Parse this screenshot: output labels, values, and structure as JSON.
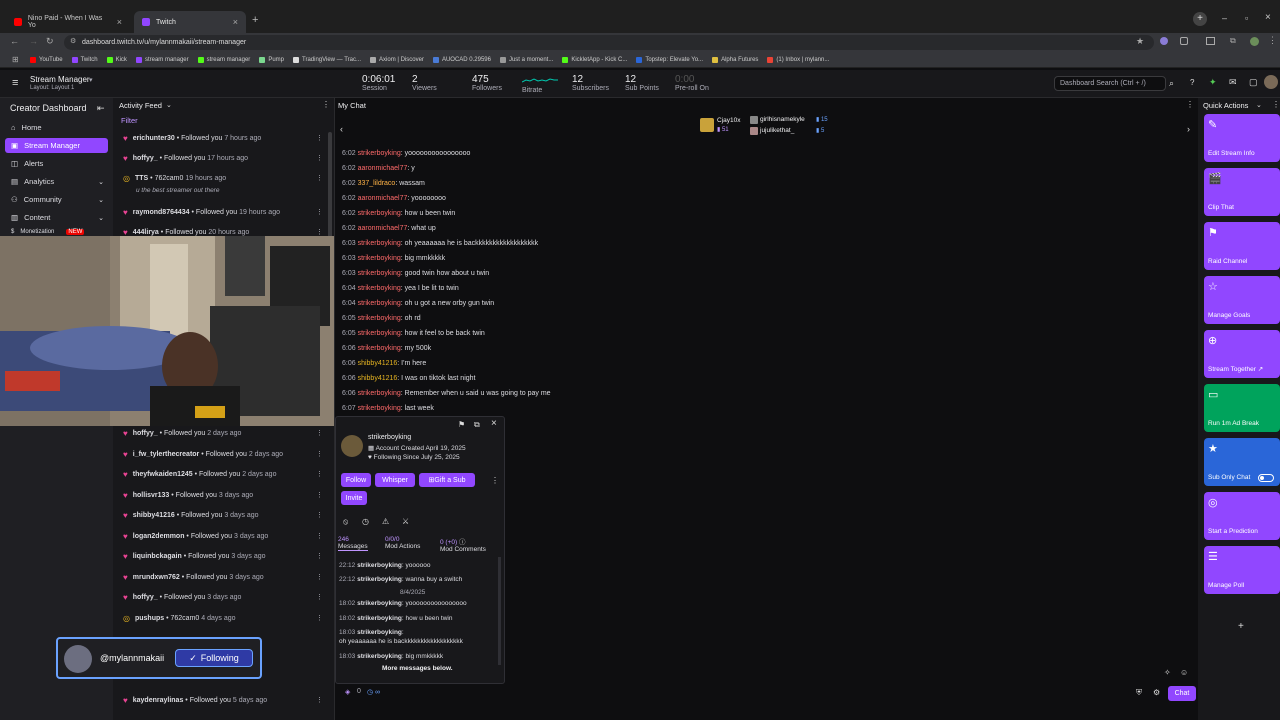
{
  "browser": {
    "tabs": [
      {
        "title": "Nino Paid - When I Was Yo",
        "favicon_color": "#ff0000"
      },
      {
        "title": "Twitch",
        "favicon_color": "#9146ff"
      }
    ],
    "url": "dashboard.twitch.tv/u/mylannmakaii/stream-manager",
    "bookmarks": [
      "YouTube",
      "Twitch",
      "Kick",
      "stream manager",
      "stream manager",
      "Pump",
      "TradingView — Trac...",
      "Axiom | Discover",
      "AUOCAD 0.29596",
      "Just a moment...",
      "KickletApp - Kick C...",
      "Topstep: Elevate Yo...",
      "Alpha Futures",
      "(1) Inbox | mylann..."
    ]
  },
  "header": {
    "title": "Stream Manager",
    "subtitle": "Layout: Layout 1",
    "stats": [
      {
        "value": "0:06:01",
        "label": "Session"
      },
      {
        "value": "2",
        "label": "Viewers"
      },
      {
        "value": "475",
        "label": "Followers"
      },
      {
        "value": "",
        "label": "Bitrate"
      },
      {
        "value": "12",
        "label": "Subscribers"
      },
      {
        "value": "12",
        "label": "Sub Points"
      },
      {
        "value": "0:00",
        "label": "Pre-roll On"
      }
    ],
    "search_placeholder": "Dashboard Search (Ctrl + /)"
  },
  "sidebar": {
    "title": "Creator Dashboard",
    "items": [
      {
        "label": "Home"
      },
      {
        "label": "Stream Manager"
      },
      {
        "label": "Alerts"
      },
      {
        "label": "Analytics"
      },
      {
        "label": "Community"
      },
      {
        "label": "Content"
      },
      {
        "label": "Monetization"
      }
    ],
    "new_badge": "NEW"
  },
  "feed": {
    "title": "Activity Feed",
    "filter": "Filter",
    "items": [
      {
        "name": "erichunter30",
        "action": "Followed you",
        "time": "7 hours ago",
        "type": "follow"
      },
      {
        "name": "hoffyy_",
        "action": "Followed you",
        "time": "17 hours ago",
        "type": "follow"
      },
      {
        "name": "TTS",
        "action": "762cam0",
        "time": "19 hours ago",
        "type": "points",
        "note": "u the best streamer out there"
      },
      {
        "name": "raymond8764434",
        "action": "Followed you",
        "time": "19 hours ago",
        "type": "follow"
      },
      {
        "name": "444lirya",
        "action": "Followed you",
        "time": "20 hours ago",
        "type": "follow"
      },
      {
        "name": "hoffyy_",
        "action": "Followed you",
        "time": "2 days ago",
        "type": "follow"
      },
      {
        "name": "i_fw_tylerthecreator",
        "action": "Followed you",
        "time": "2 days ago",
        "type": "follow"
      },
      {
        "name": "theyfwkaiden1245",
        "action": "Followed you",
        "time": "2 days ago",
        "type": "follow"
      },
      {
        "name": "hollisvr133",
        "action": "Followed you",
        "time": "3 days ago",
        "type": "follow"
      },
      {
        "name": "shibby41216",
        "action": "Followed you",
        "time": "3 days ago",
        "type": "follow"
      },
      {
        "name": "logan2demmon",
        "action": "Followed you",
        "time": "3 days ago",
        "type": "follow"
      },
      {
        "name": "liquinbckagain",
        "action": "Followed you",
        "time": "3 days ago",
        "type": "follow"
      },
      {
        "name": "mrundxwn762",
        "action": "Followed you",
        "time": "3 days ago",
        "type": "follow"
      },
      {
        "name": "hoffyy_",
        "action": "Followed you",
        "time": "3 days ago",
        "type": "follow"
      },
      {
        "name": "pushups",
        "action": "762cam0",
        "time": "4 days ago",
        "type": "points"
      },
      {
        "name": "kaydenraylinas",
        "action": "Followed you",
        "time": "5 days ago",
        "type": "follow"
      }
    ]
  },
  "follow_card": {
    "handle": "@mylannmakaii",
    "button": "Following"
  },
  "chat": {
    "title": "My Chat",
    "top_users": [
      {
        "name": "Cjay10x",
        "count": "51"
      },
      {
        "name": "girlhisnamekyle",
        "count": "15"
      },
      {
        "name": "jujulikethat_",
        "count": "5"
      }
    ],
    "messages": [
      {
        "time": "6:02",
        "user": "strikerboyking",
        "color": "#ff6a6a",
        "text": "yoooooooooooooooo"
      },
      {
        "time": "6:02",
        "user": "aaronmichael77",
        "color": "#ff6a6a",
        "text": "y"
      },
      {
        "time": "6:02",
        "user": "337_lildraco",
        "color": "#ffb347",
        "text": "wassam"
      },
      {
        "time": "6:02",
        "user": "aaronmichael77",
        "color": "#ff6a6a",
        "text": "yoooooooo"
      },
      {
        "time": "6:02",
        "user": "strikerboyking",
        "color": "#ff6a6a",
        "text": "how u been twin"
      },
      {
        "time": "6:02",
        "user": "aaronmichael77",
        "color": "#ff6a6a",
        "text": "what up"
      },
      {
        "time": "6:03",
        "user": "strikerboyking",
        "color": "#ff6a6a",
        "text": "oh yeaaaaaa he is backkkkkkkkkkkkkkkkkk"
      },
      {
        "time": "6:03",
        "user": "strikerboyking",
        "color": "#ff6a6a",
        "text": "big mmkkkkk"
      },
      {
        "time": "6:03",
        "user": "strikerboyking",
        "color": "#ff6a6a",
        "text": "good twin how about u twin"
      },
      {
        "time": "6:04",
        "user": "strikerboyking",
        "color": "#ff6a6a",
        "text": "yea I be lit to twin"
      },
      {
        "time": "6:04",
        "user": "strikerboyking",
        "color": "#ff6a6a",
        "text": "oh u got a new orby gun twin"
      },
      {
        "time": "6:05",
        "user": "strikerboyking",
        "color": "#ff6a6a",
        "text": "oh rd"
      },
      {
        "time": "6:05",
        "user": "strikerboyking",
        "color": "#ff6a6a",
        "text": "how it feel to be back twin"
      },
      {
        "time": "6:06",
        "user": "strikerboyking",
        "color": "#ff6a6a",
        "text": "my 500k"
      },
      {
        "time": "6:06",
        "user": "shibby41216",
        "color": "#e6b422",
        "text": "I'm here"
      },
      {
        "time": "6:06",
        "user": "shibby41216",
        "color": "#e6b422",
        "text": "I was on tiktok last night"
      },
      {
        "time": "6:06",
        "user": "strikerboyking",
        "color": "#ff6a6a",
        "text": "Remember when u said u was going to pay me"
      },
      {
        "time": "6:07",
        "user": "strikerboyking",
        "color": "#ff6a6a",
        "text": "last week"
      }
    ]
  },
  "user_card": {
    "username": "strikerboyking",
    "created": "Account Created April 19, 2025",
    "following": "Following Since July 25, 2025",
    "buttons": [
      "Follow",
      "Whisper",
      "Gift a Sub",
      "Invite"
    ],
    "stats": [
      {
        "value": "246",
        "label": "Messages"
      },
      {
        "value": "0/0/0",
        "label": "Mod Actions"
      },
      {
        "value": "0 (+0)",
        "label": "Mod Comments"
      }
    ],
    "log": [
      {
        "time": "22:12",
        "user": "strikerboyking",
        "text": "yoooooo"
      },
      {
        "time": "22:12",
        "user": "strikerboyking",
        "text": "wanna buy a switch"
      },
      {
        "date": "8/4/2025"
      },
      {
        "time": "18:02",
        "user": "strikerboyking",
        "text": "yoooooooooooooooo"
      },
      {
        "time": "18:02",
        "user": "strikerboyking",
        "text": "how u been twin"
      },
      {
        "time": "18:03",
        "user": "strikerboyking",
        "text": ""
      },
      {
        "time": "",
        "user": "",
        "text": "oh yeaaaaaa he is backkkkkkkkkkkkkkkkkk"
      },
      {
        "time": "18:03",
        "user": "strikerboyking",
        "text": "big mmkkkkk"
      }
    ],
    "more": "More messages below."
  },
  "bottom": {
    "points": "0",
    "chat_button": "Chat"
  },
  "quick_actions": {
    "title": "Quick Actions",
    "items": [
      {
        "label": "Edit Stream Info",
        "color": "#9147ff",
        "icon": "pencil-icon",
        "glyph": "✎"
      },
      {
        "label": "Clip That",
        "color": "#9147ff",
        "icon": "clip-icon",
        "glyph": "🎬"
      },
      {
        "label": "Raid Channel",
        "color": "#9147ff",
        "icon": "raid-icon",
        "glyph": "⚑"
      },
      {
        "label": "Manage Goals",
        "color": "#9147ff",
        "icon": "star-icon",
        "glyph": "☆"
      },
      {
        "label": "Stream Together ↗",
        "color": "#9147ff",
        "icon": "add-person-icon",
        "glyph": "⊕"
      },
      {
        "label": "Run 1m Ad Break",
        "color": "#00a35c",
        "icon": "ad-icon",
        "glyph": "▭"
      },
      {
        "label": "Sub Only Chat",
        "color": "#2a66d8",
        "icon": "star-filled-icon",
        "glyph": "★"
      },
      {
        "label": "Start a Prediction",
        "color": "#9147ff",
        "icon": "prediction-icon",
        "glyph": "◎"
      },
      {
        "label": "Manage Poll",
        "color": "#9147ff",
        "icon": "poll-icon",
        "glyph": "☰"
      }
    ],
    "add": "+"
  }
}
